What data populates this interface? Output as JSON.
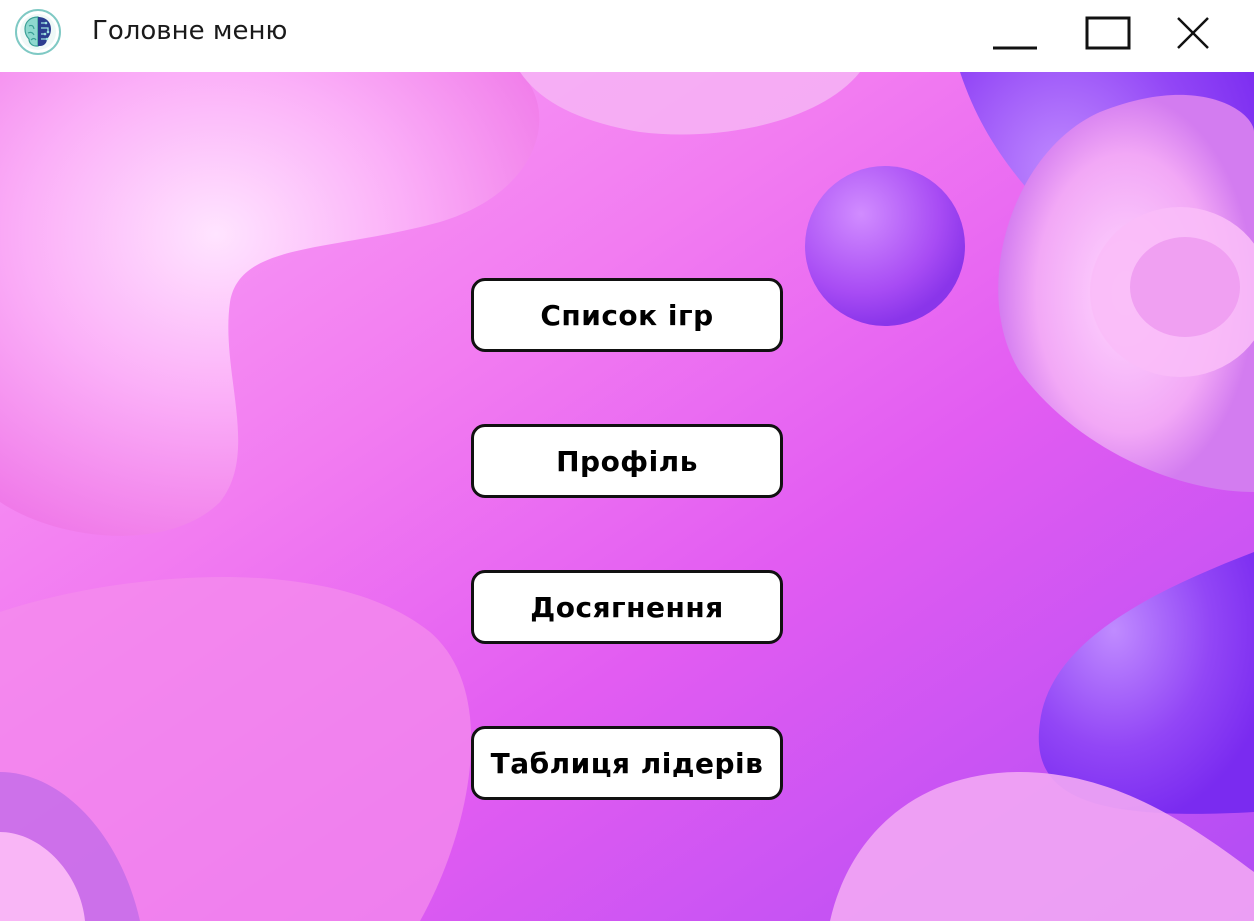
{
  "window": {
    "title": "Головне меню"
  },
  "icons": {
    "app": "brain-icon",
    "minimize": "minimize-icon",
    "maximize": "maximize-icon",
    "close": "close-icon"
  },
  "menu": {
    "games_label": "Список ігр",
    "profile_label": "Профіль",
    "achievements_label": "Досягнення",
    "leaderboard_label": "Таблиця лідерів"
  },
  "colors": {
    "background_pink": "#f070f0",
    "background_violet": "#9a3cf5",
    "button_bg": "#ffffff",
    "button_border": "#111111"
  }
}
